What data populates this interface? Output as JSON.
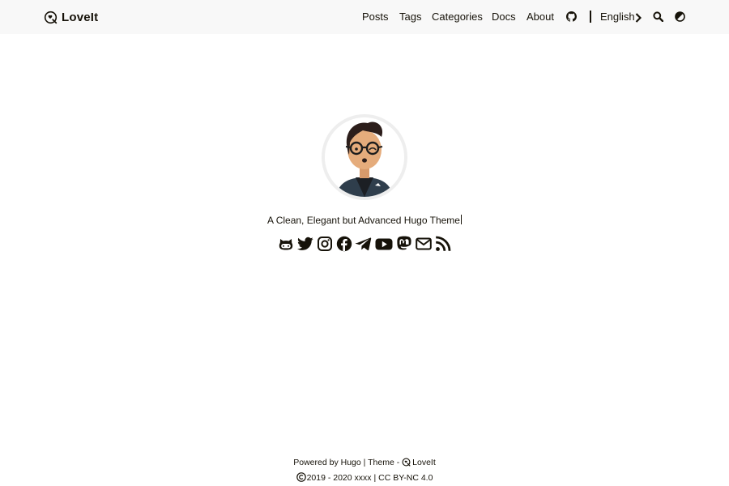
{
  "header": {
    "brand": {
      "logo_icon": "loveit-logo-icon",
      "title": "LoveIt"
    },
    "nav": {
      "posts": "Posts",
      "tags": "Tags",
      "categories": "Categories",
      "docs": "Docs",
      "about": "About",
      "github_icon": "github-icon",
      "language": "English",
      "language_icon": "chevron-right-icon",
      "search_icon": "search-icon",
      "theme_icon": "theme-toggle-icon"
    }
  },
  "profile": {
    "avatar": "avatar-image",
    "subtitle": "A Clean, Elegant but Advanced Hugo Theme",
    "social": [
      "github-icon",
      "twitter-icon",
      "instagram-icon",
      "facebook-icon",
      "telegram-icon",
      "youtube-icon",
      "mastodon-icon",
      "email-icon",
      "rss-icon"
    ]
  },
  "footer": {
    "powered_by": "Powered by",
    "hugo": "Hugo",
    "theme_sep": "| Theme -",
    "theme_name": "LoveIt",
    "years": "2019 - 2020",
    "author": "xxxx",
    "license_sep": "|",
    "license": "CC BY-NC 4.0"
  },
  "colors": {
    "header_bg": "#f8f8f8",
    "text": "#161209",
    "background": "#ffffff"
  }
}
